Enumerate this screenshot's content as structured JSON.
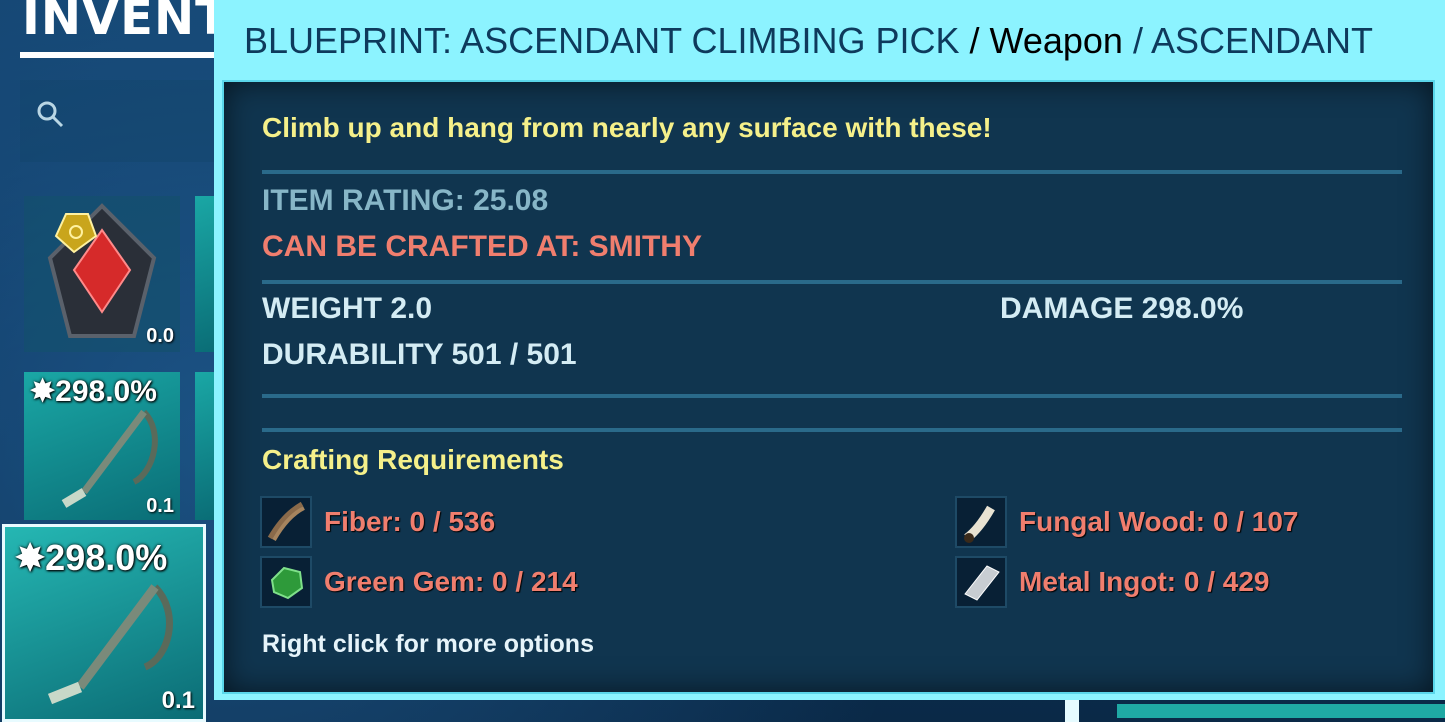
{
  "inventory": {
    "title": "INVENTO",
    "slots": [
      {
        "weight": "0.0",
        "percent": ""
      },
      {
        "weight": "0.1",
        "percent": "298.0%"
      },
      {
        "weight": "0.1",
        "percent": "298.0%"
      }
    ]
  },
  "tooltip": {
    "header_item": "BLUEPRINT: ASCENDANT CLIMBING PICK",
    "header_sep1": " / ",
    "header_type": "Weapon",
    "header_sep2": " / ",
    "header_quality": "ASCENDANT",
    "description": "Climb up and hang from nearly any surface with these!",
    "item_rating": "ITEM RATING: 25.08",
    "crafted_at": "CAN BE CRAFTED AT: SMITHY",
    "weight": "WEIGHT 2.0",
    "damage": "DAMAGE 298.0%",
    "durability": "DURABILITY 501 / 501",
    "requirements_title": "Crafting Requirements",
    "requirements": [
      {
        "label": "Fiber: 0 / 536",
        "icon": "fiber-icon"
      },
      {
        "label": "Fungal Wood: 0 / 107",
        "icon": "fungal-wood-icon"
      },
      {
        "label": "Green Gem: 0 / 214",
        "icon": "green-gem-icon"
      },
      {
        "label": "Metal Ingot: 0 / 429",
        "icon": "metal-ingot-icon"
      }
    ],
    "hint": "Right click for more options"
  },
  "colors": {
    "header_bg": "#8cf3ff",
    "desc": "#f5f08a",
    "warning": "#f07e6e",
    "body_bg": "#0a2a46"
  }
}
